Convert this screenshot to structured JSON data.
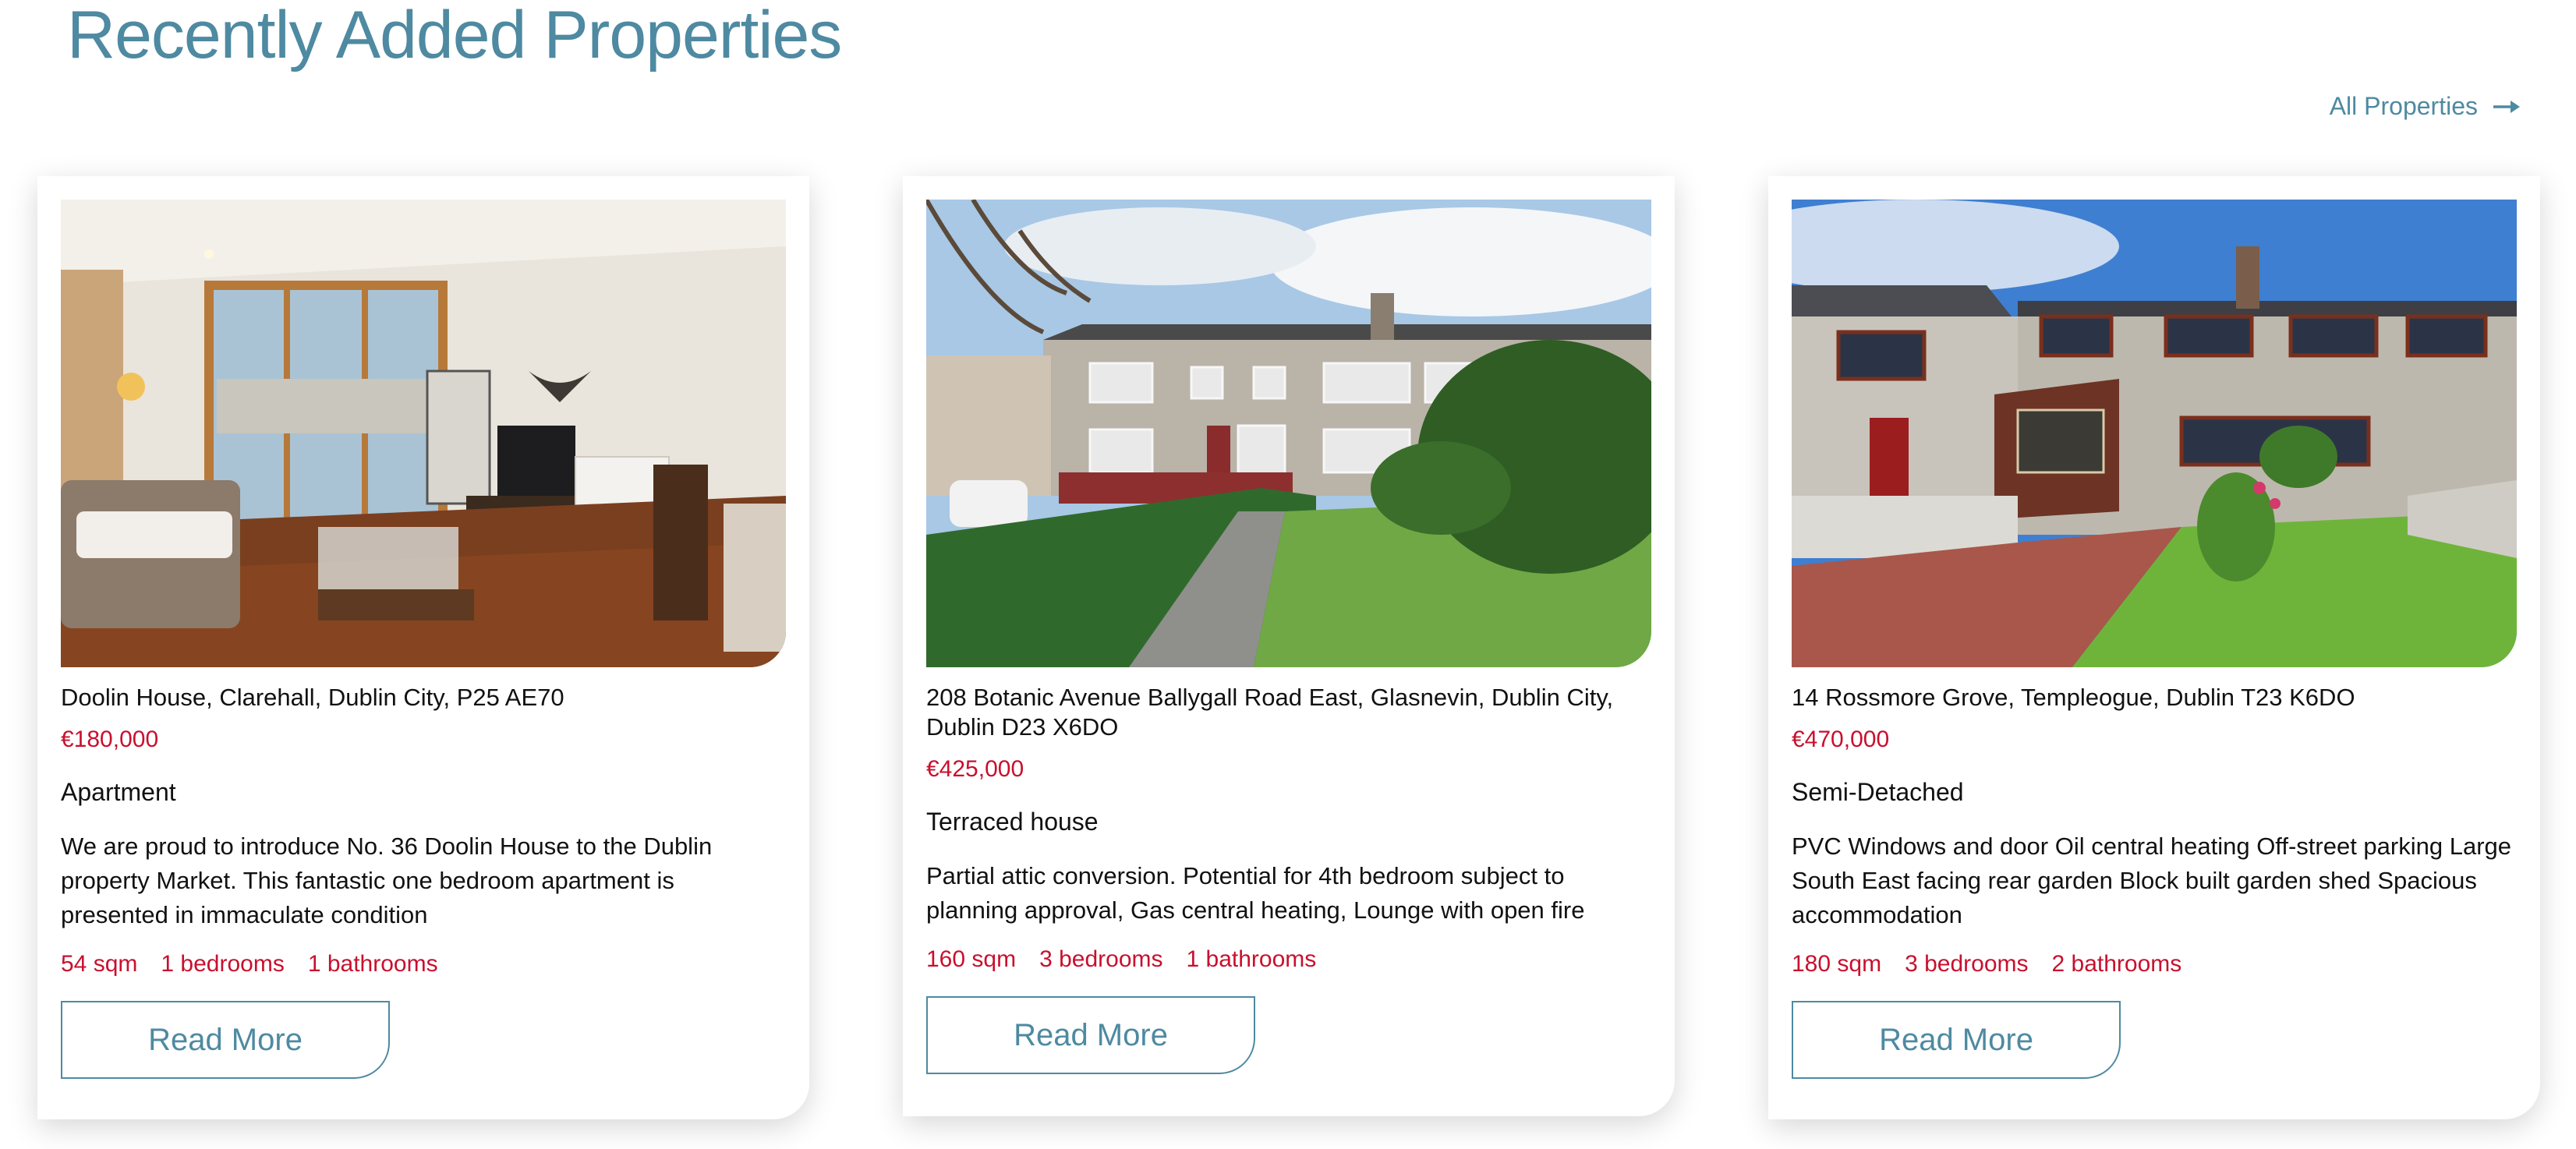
{
  "section": {
    "title": "Recently Added Properties",
    "all_link": "All Properties"
  },
  "colors": {
    "accent": "#4e8aa1",
    "price": "#c8102e",
    "text": "#111111"
  },
  "cards": [
    {
      "image": "living-room-photo",
      "address": "Doolin House, Clarehall, Dublin City, P25 AE70",
      "price": "€180,000",
      "type": "Apartment",
      "description": "We are proud to introduce No. 36 Doolin House to the Dublin property Market. This fantastic one bedroom apartment is presented in immaculate condition",
      "sqm": "54 sqm",
      "bedrooms": "1 bedrooms",
      "bathrooms": "1 bathrooms",
      "button": "Read More"
    },
    {
      "image": "terraced-house-photo",
      "address": "208 Botanic Avenue Ballygall Road East, Glasnevin, Dublin City, Dublin D23 X6DO",
      "price": "€425,000",
      "type": "Terraced house",
      "description": "Partial attic conversion. Potential for 4th bedroom subject to planning approval, Gas central heating, Lounge with open fire",
      "sqm": "160 sqm",
      "bedrooms": "3 bedrooms",
      "bathrooms": "1 bathrooms",
      "button": "Read More"
    },
    {
      "image": "semi-detached-house-photo",
      "address": "14 Rossmore Grove, Templeogue, Dublin T23 K6DO",
      "price": "€470,000",
      "type": "Semi-Detached",
      "description": "PVC Windows and door Oil central heating Off-street parking Large South East facing rear garden Block built garden shed Spacious accommodation",
      "sqm": "180 sqm",
      "bedrooms": "3 bedrooms",
      "bathrooms": "2 bathrooms",
      "button": "Read More"
    }
  ]
}
